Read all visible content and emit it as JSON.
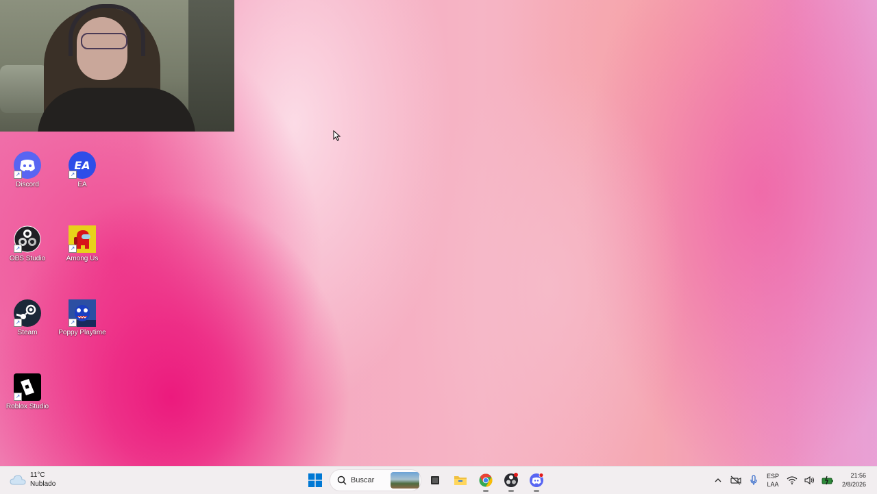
{
  "desktop": {
    "icons": [
      {
        "label": "Discord",
        "icon": "discord-icon",
        "color": "#5865f2"
      },
      {
        "label": "EA",
        "icon": "ea-icon",
        "color": "#2e4de8"
      },
      {
        "label": "OBS Studio",
        "icon": "obs-icon",
        "color": "#1f1f24"
      },
      {
        "label": "Among Us",
        "icon": "among-us-icon",
        "color": "#e8d21a"
      },
      {
        "label": "Steam",
        "icon": "steam-icon",
        "color": "#1b2838"
      },
      {
        "label": "Poppy Playtime",
        "icon": "poppy-playtime-icon",
        "color": "#2c4fa3"
      },
      {
        "label": "Roblox Studio",
        "icon": "roblox-studio-icon",
        "color": "#000000"
      }
    ]
  },
  "webcam": {
    "description_icon": "webcam-feed"
  },
  "taskbar": {
    "weather": {
      "temp": "11°C",
      "condition": "Nublado"
    },
    "search": {
      "placeholder": "Buscar"
    },
    "pinned": [
      {
        "name": "start-button",
        "icon": "windows-logo-icon"
      },
      {
        "name": "task-view",
        "icon": "task-view-icon"
      },
      {
        "name": "file-explorer",
        "icon": "folder-icon"
      },
      {
        "name": "chrome",
        "icon": "chrome-icon"
      },
      {
        "name": "obs",
        "icon": "obs-icon"
      },
      {
        "name": "discord",
        "icon": "discord-icon"
      }
    ],
    "tray": {
      "language": "ESP",
      "layout": "LAA",
      "time": "21:56",
      "date": "2/8/2026"
    }
  },
  "colors": {
    "accent_blue": "#0078d4",
    "discord": "#5865f2",
    "chrome_red": "#ea4335",
    "chrome_yellow": "#fbbc05",
    "chrome_green": "#34a853"
  }
}
